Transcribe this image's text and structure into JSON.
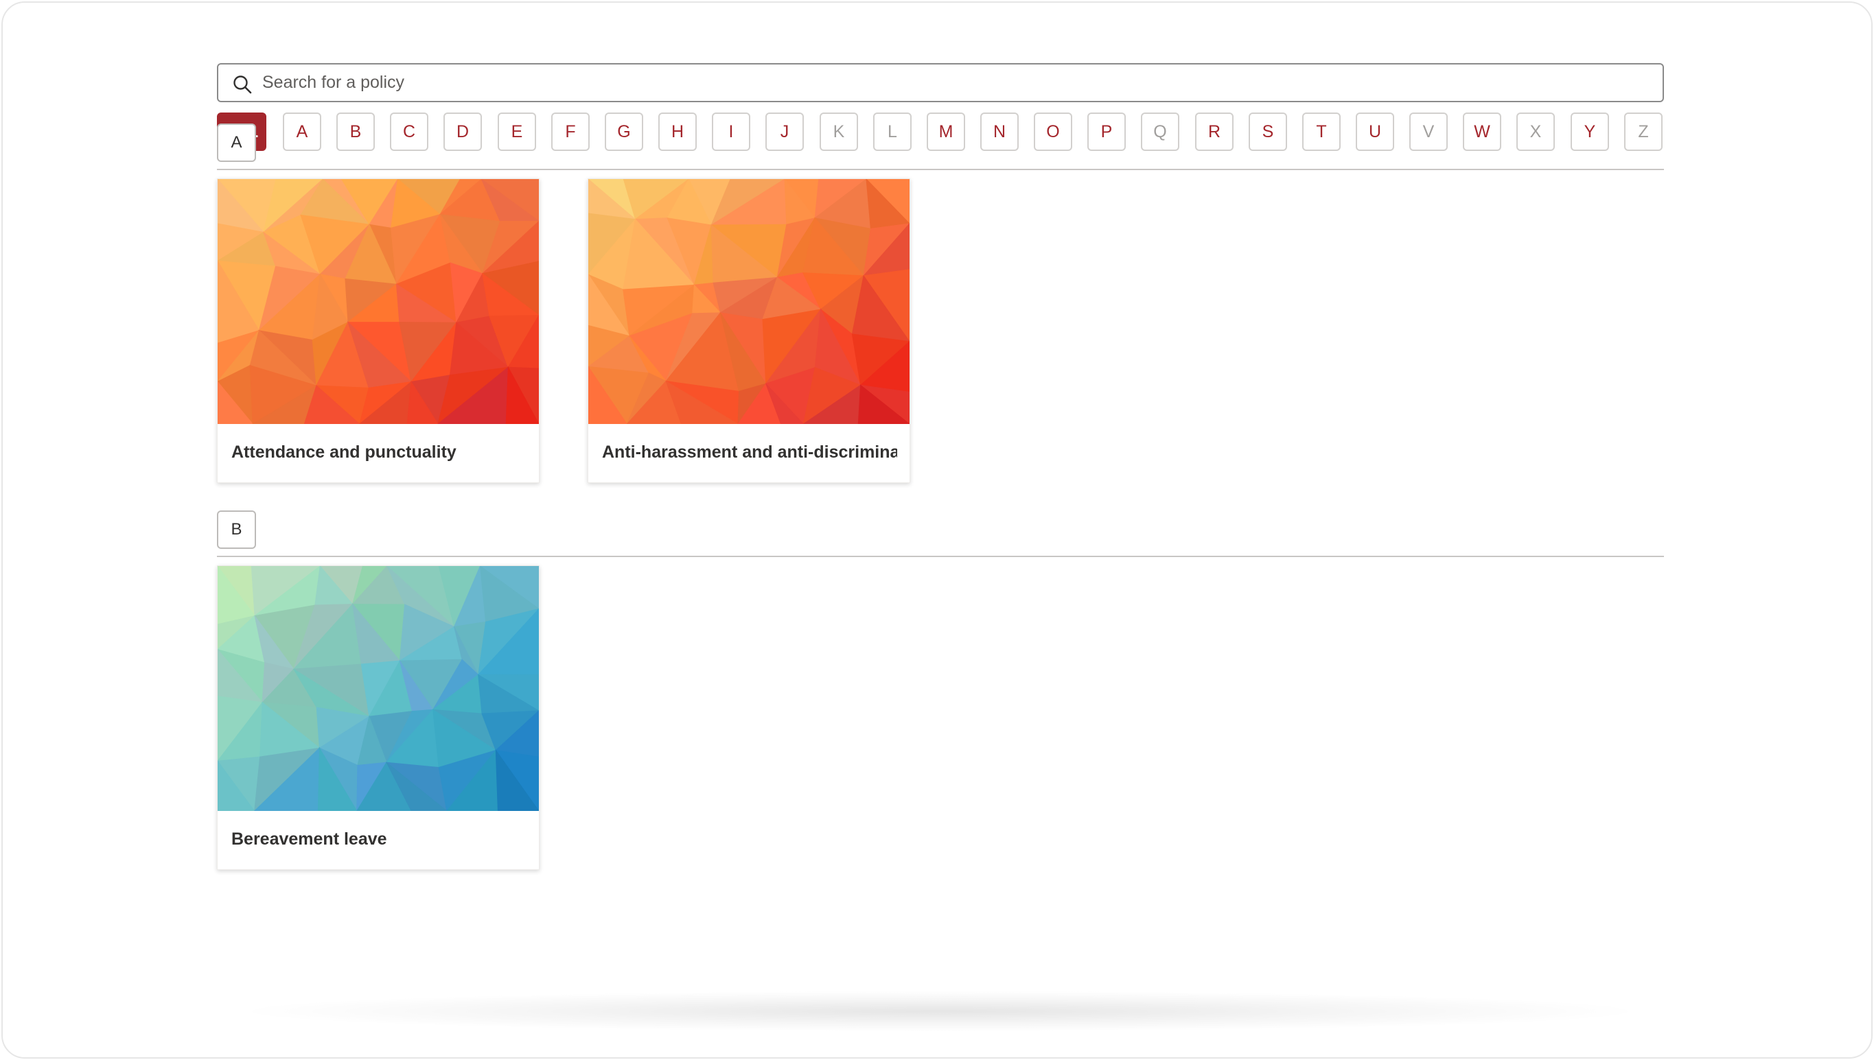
{
  "search": {
    "placeholder": "Search for a policy",
    "value": ""
  },
  "letters": {
    "all_label": "ALL",
    "items": [
      {
        "label": "A",
        "enabled": true
      },
      {
        "label": "B",
        "enabled": true
      },
      {
        "label": "C",
        "enabled": true
      },
      {
        "label": "D",
        "enabled": true
      },
      {
        "label": "E",
        "enabled": true
      },
      {
        "label": "F",
        "enabled": true
      },
      {
        "label": "G",
        "enabled": true
      },
      {
        "label": "H",
        "enabled": true
      },
      {
        "label": "I",
        "enabled": true
      },
      {
        "label": "J",
        "enabled": true
      },
      {
        "label": "K",
        "enabled": false
      },
      {
        "label": "L",
        "enabled": false
      },
      {
        "label": "M",
        "enabled": true
      },
      {
        "label": "N",
        "enabled": true
      },
      {
        "label": "O",
        "enabled": true
      },
      {
        "label": "P",
        "enabled": true
      },
      {
        "label": "Q",
        "enabled": false
      },
      {
        "label": "R",
        "enabled": true
      },
      {
        "label": "S",
        "enabled": true
      },
      {
        "label": "T",
        "enabled": true
      },
      {
        "label": "U",
        "enabled": true
      },
      {
        "label": "V",
        "enabled": false
      },
      {
        "label": "W",
        "enabled": true
      },
      {
        "label": "X",
        "enabled": false
      },
      {
        "label": "Y",
        "enabled": true
      },
      {
        "label": "Z",
        "enabled": false
      }
    ]
  },
  "sections": [
    {
      "letter": "A",
      "cards": [
        {
          "title": "Attendance and punctuality",
          "theme": "warm"
        },
        {
          "title": "Anti-harassment and anti-discrimina...",
          "theme": "warm"
        }
      ]
    },
    {
      "letter": "B",
      "cards": [
        {
          "title": "Bereavement leave",
          "theme": "cool"
        }
      ]
    }
  ],
  "colors": {
    "accent": "#a4262c",
    "disabled_letter": "#a19f9d",
    "warm_gradient": [
      "#ffd97a",
      "#ff9a4a",
      "#f2552c",
      "#dc1a22"
    ],
    "cool_gradient": [
      "#c6e8bf",
      "#8fcdb9",
      "#43a8d0",
      "#1c78b8"
    ]
  }
}
